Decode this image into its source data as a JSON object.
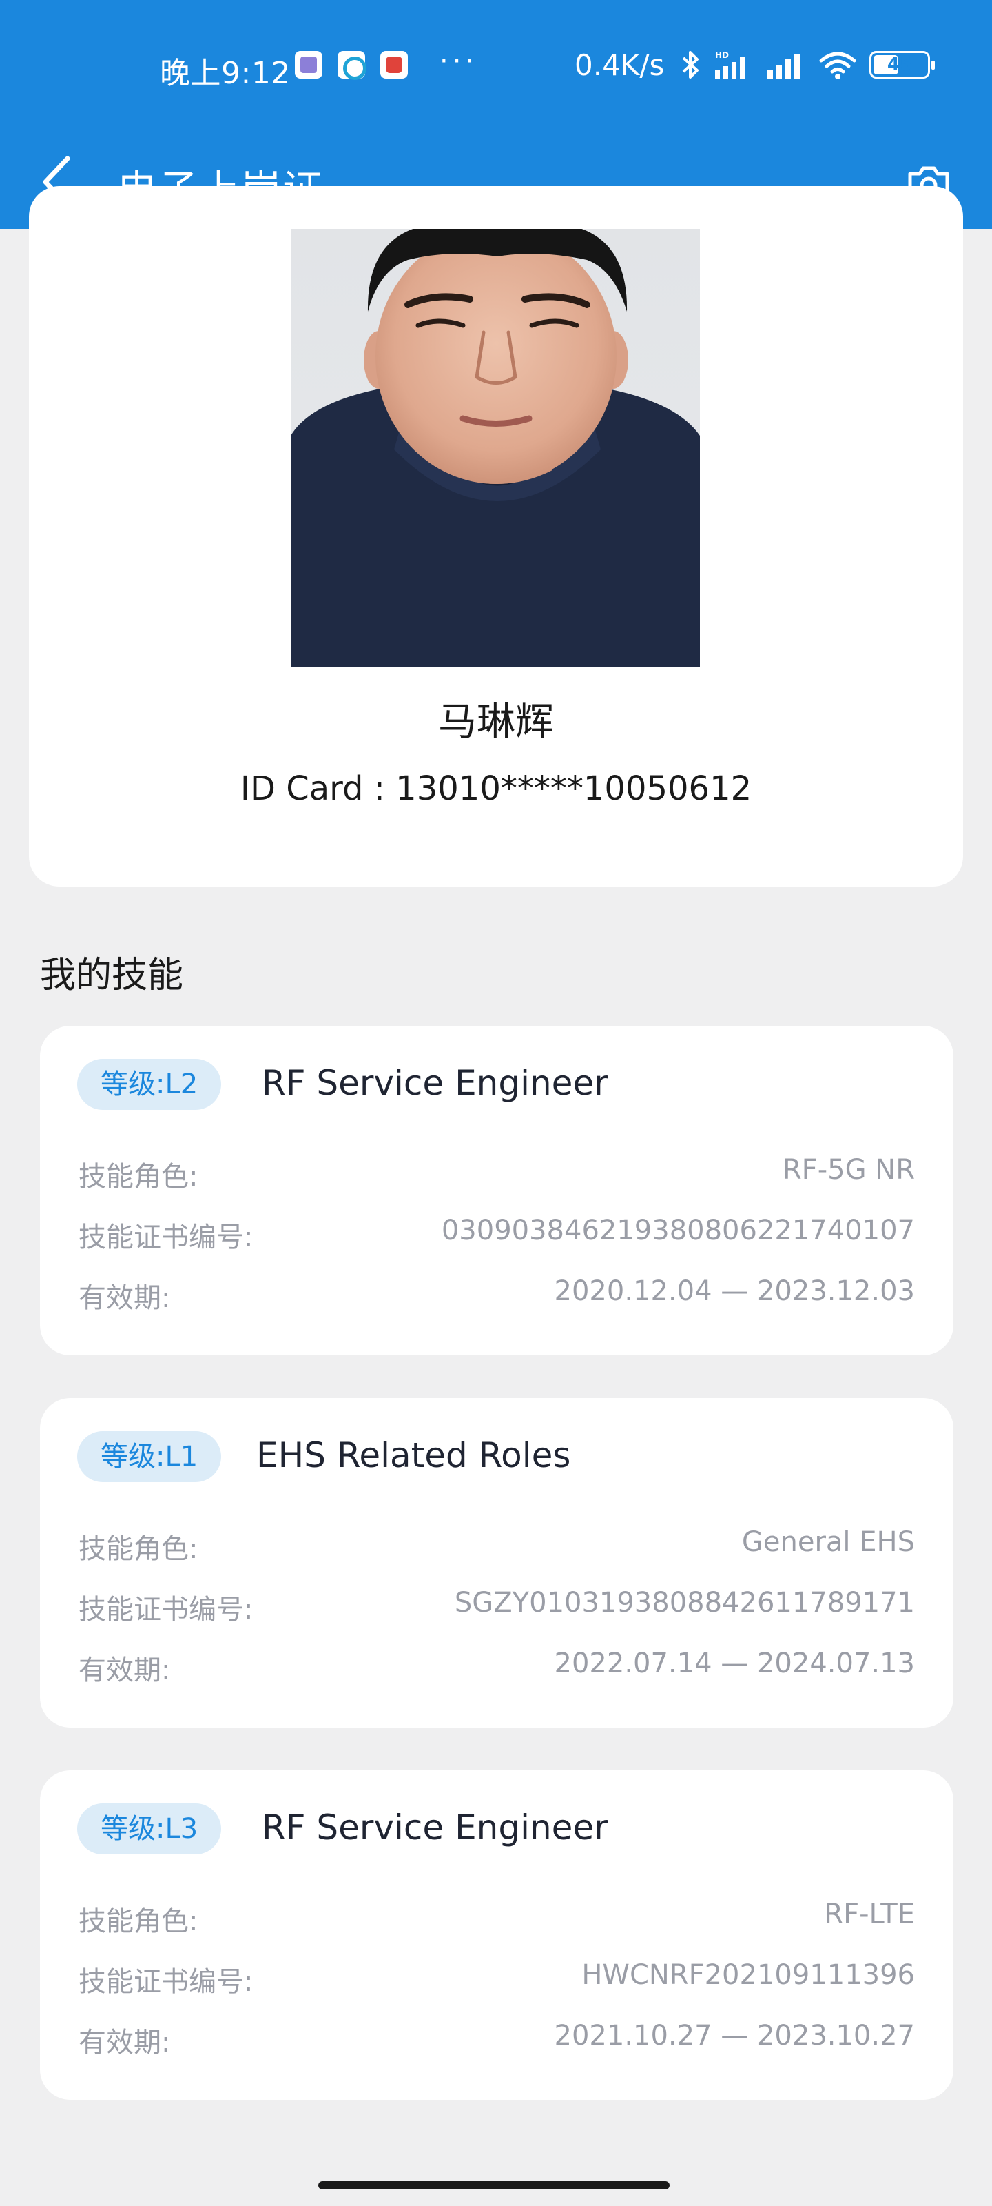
{
  "status_bar": {
    "time": "晚上9:12",
    "dots": "···",
    "network_speed": "0.4K/s",
    "battery": "45",
    "icons": [
      "app-icon",
      "app-icon",
      "app-icon",
      "bluetooth-icon",
      "hd-signal-icon",
      "signal-icon",
      "wifi-icon",
      "battery-icon"
    ]
  },
  "header": {
    "title": "电子上岗证",
    "back_icon": "chevron-left-icon",
    "camera_icon": "camera-icon",
    "background_color": "#1b87dd"
  },
  "profile": {
    "name": "马琳辉",
    "id_card": "ID Card : 13010*****10050612"
  },
  "skills_section": {
    "title": "我的技能",
    "labels": {
      "role": "技能角色:",
      "certificate": "技能证书编号:",
      "validity": "有效期:"
    },
    "items": [
      {
        "level": "等级:L2",
        "name": "RF Service Engineer",
        "role": "RF-5G NR",
        "certificate": "030903846219380806221740107",
        "validity": "2020.12.04 — 2023.12.03"
      },
      {
        "level": "等级:L1",
        "name": "EHS Related Roles",
        "role": "General EHS",
        "certificate": "SGZY010319380884261178917​1",
        "validity": "2022.07.14 — 2024.07.13"
      },
      {
        "level": "等级:L3",
        "name": "RF Service Engineer",
        "role": "RF-LTE",
        "certificate": "HWCNRF202109111396",
        "validity": "2021.10.27 — 2023.10.27"
      }
    ]
  },
  "colors": {
    "accent": "#1b87dd",
    "badge_bg": "#dcecf8",
    "page_bg": "#efeff0",
    "muted_text": "#9a9da6"
  }
}
